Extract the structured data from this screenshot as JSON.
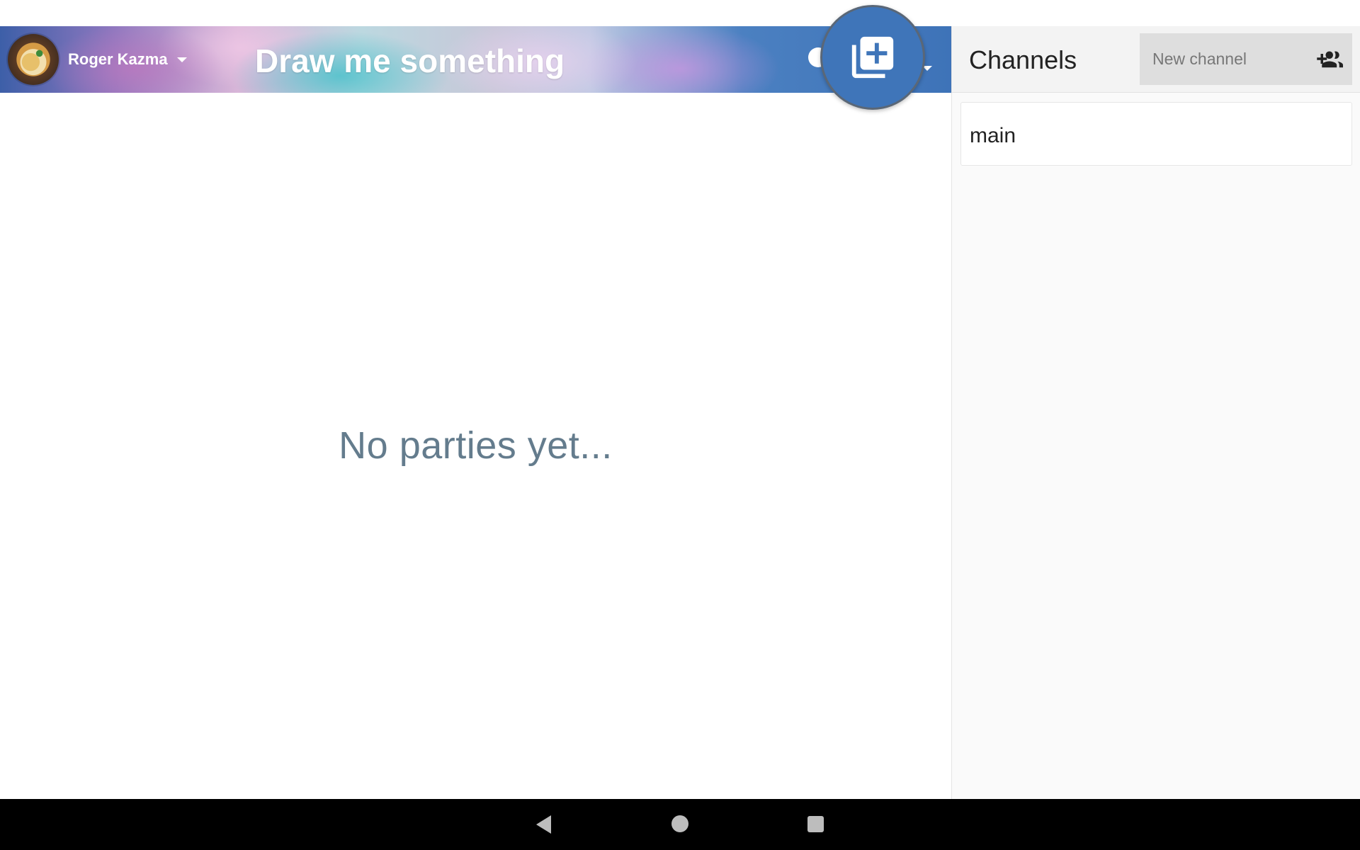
{
  "header": {
    "user_name": "Roger Kazma",
    "title": "Draw me something"
  },
  "fab": {
    "icon": "add-to-collection-icon",
    "color": "#3f75b9"
  },
  "main": {
    "empty_message": "No parties yet..."
  },
  "sidebar": {
    "title": "Channels",
    "new_channel_placeholder": "New channel",
    "add_icon": "group-add-icon",
    "channels": [
      {
        "name": "main"
      }
    ]
  },
  "system_nav": {
    "back_icon": "back-icon",
    "home_icon": "home-icon",
    "recents_icon": "recents-icon"
  }
}
